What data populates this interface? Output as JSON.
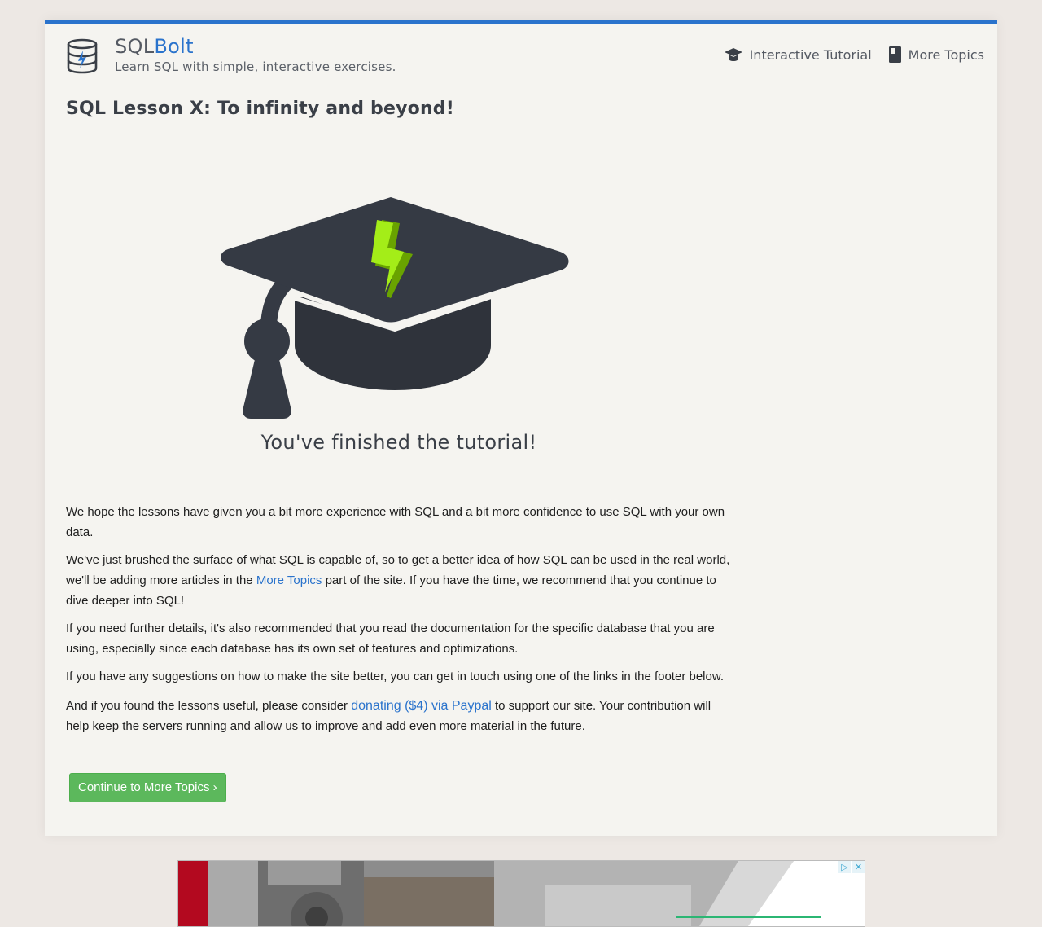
{
  "header": {
    "brand_prefix": "SQL",
    "brand_accent": "Bolt",
    "tagline": "Learn SQL with simple, interactive exercises.",
    "nav": [
      {
        "label": "Interactive Tutorial",
        "icon": "graduation-cap-icon"
      },
      {
        "label": "More Topics",
        "icon": "book-icon"
      }
    ]
  },
  "lesson": {
    "title": "SQL Lesson X: To infinity and beyond!",
    "finished_text": "You've finished the tutorial!",
    "paragraphs": {
      "p1": "We hope the lessons have given you a bit more experience with SQL and a bit more confidence to use SQL with your own data.",
      "p2_before": "We've just brushed the surface of what SQL is capable of, so to get a better idea of how SQL can be used in the real world, we'll be adding more articles in the ",
      "p2_link": "More Topics",
      "p2_after": " part of the site. If you have the time, we recommend that you continue to dive deeper into SQL!",
      "p3": "If you need further details, it's also recommended that you read the documentation for the specific database that you are using, especially since each database has its own set of features and optimizations.",
      "p4": "If you have any suggestions on how to make the site better, you can get in touch using one of the links in the footer below.",
      "p5_before": "And if you found the lessons useful, please consider ",
      "p5_link": "donating ($4) via Paypal",
      "p5_after": " to support our site. Your contribution will help keep the servers running and allow us to improve and add even more material in the future."
    },
    "continue_button": "Continue to More Topics ›"
  },
  "ad": {
    "controls": [
      "▷",
      "✕"
    ]
  },
  "colors": {
    "accent": "#2a73cc",
    "button_green": "#5cb85c",
    "cap_dark": "#353a44",
    "bolt_green": "#8fd400"
  }
}
